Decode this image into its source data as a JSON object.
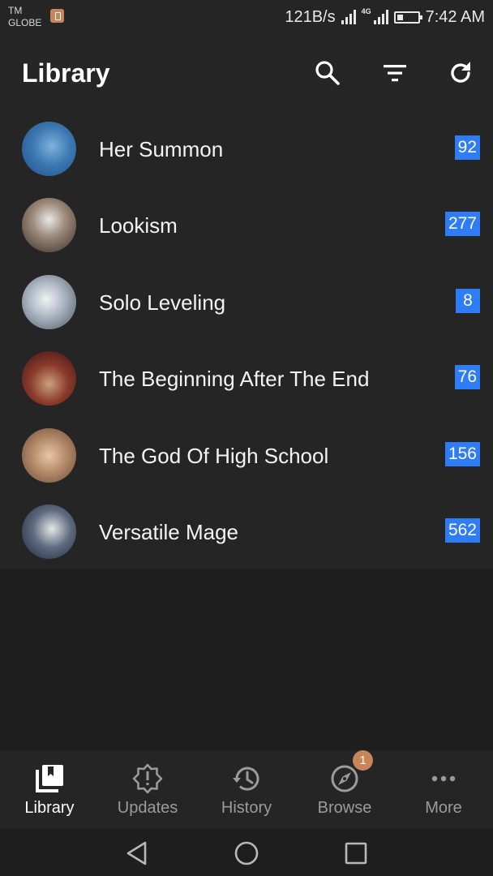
{
  "status_bar": {
    "carrier_line1": "TM",
    "carrier_line2": "GLOBE",
    "net_speed": "121B/s",
    "network_type": "4G",
    "time": "7:42 AM"
  },
  "app_bar": {
    "title": "Library",
    "actions": [
      "search-icon",
      "filter-icon",
      "refresh-icon"
    ]
  },
  "library": {
    "items": [
      {
        "title": "Her Summon",
        "unread": "92",
        "cover_colors": [
          "#1f4f86",
          "#7fb3de"
        ]
      },
      {
        "title": "Lookism",
        "unread": "277",
        "cover_colors": [
          "#d8d8d8",
          "#3a2d25"
        ]
      },
      {
        "title": "Solo Leveling",
        "unread": "8",
        "cover_colors": [
          "#dde3ea",
          "#4a5563"
        ]
      },
      {
        "title": "The Beginning After The End",
        "unread": "76",
        "cover_colors": [
          "#6b1f1a",
          "#c9a27a"
        ]
      },
      {
        "title": "The God Of High School",
        "unread": "156",
        "cover_colors": [
          "#d3b08a",
          "#6b4a36"
        ]
      },
      {
        "title": "Versatile Mage",
        "unread": "562",
        "cover_colors": [
          "#1d2638",
          "#e6e6e6"
        ]
      }
    ]
  },
  "bottom_nav": {
    "items": [
      {
        "label": "Library",
        "icon": "library-icon",
        "active": true
      },
      {
        "label": "Updates",
        "icon": "updates-icon",
        "active": false
      },
      {
        "label": "History",
        "icon": "history-icon",
        "active": false
      },
      {
        "label": "Browse",
        "icon": "compass-icon",
        "active": false,
        "badge": "1"
      },
      {
        "label": "More",
        "icon": "more-icon",
        "active": false
      }
    ]
  },
  "system_nav": [
    "back-icon",
    "home-icon",
    "recents-icon"
  ],
  "colors": {
    "background": "#1e1e1e",
    "surface": "#252525",
    "badge_blue": "#2e7cf6",
    "accent_badge": "#c9855a",
    "inactive_text": "#9b9b9b"
  }
}
